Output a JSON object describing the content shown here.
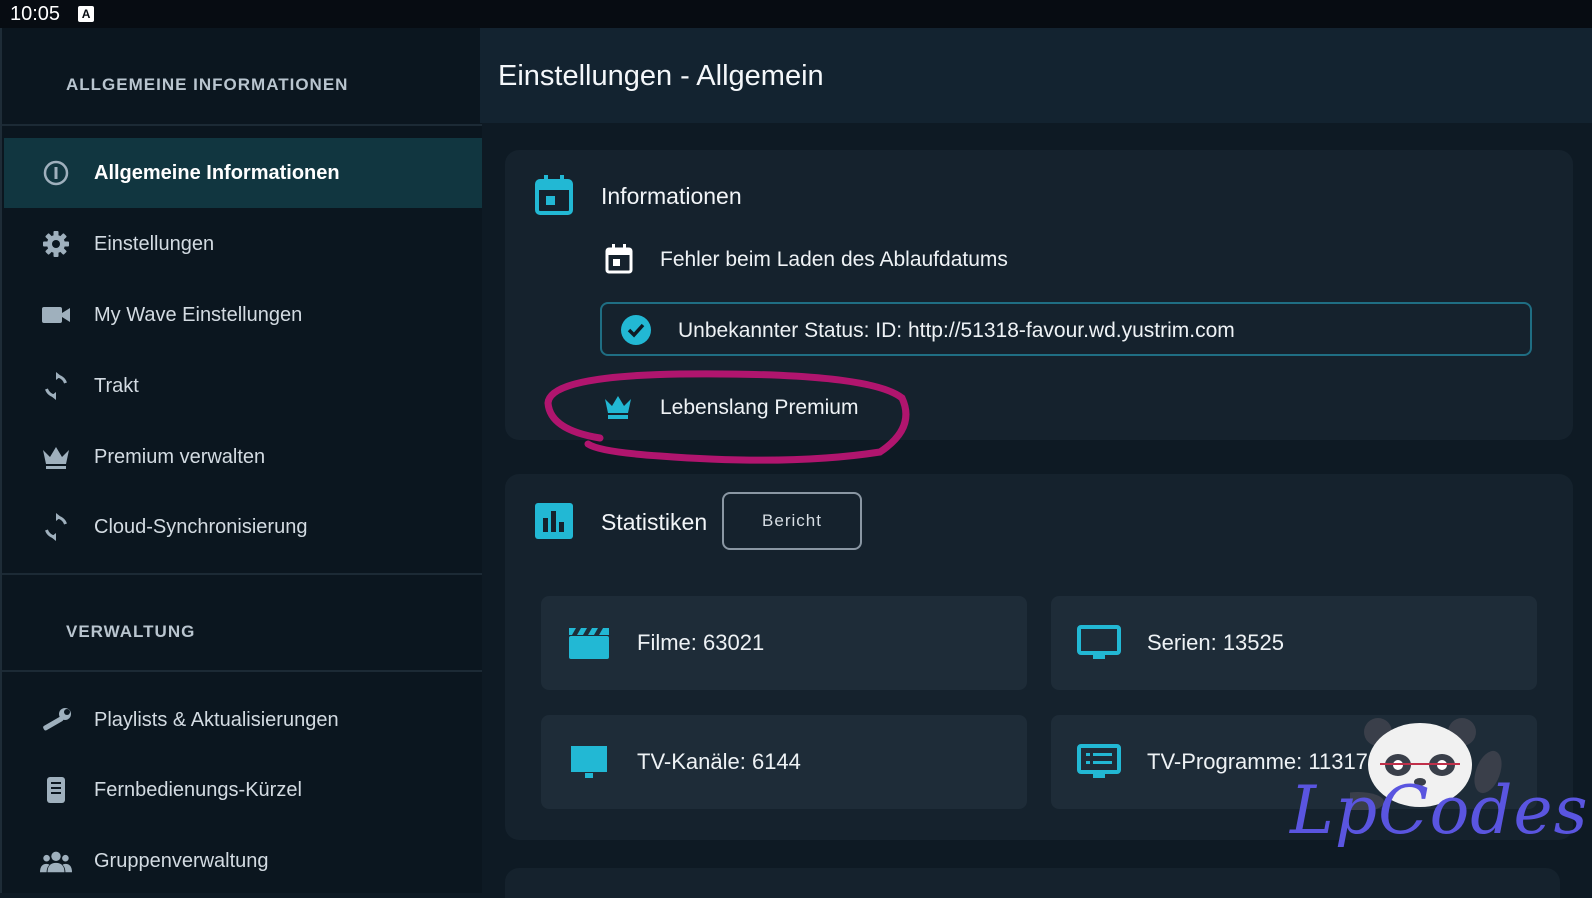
{
  "status_bar": {
    "time": "10:05",
    "notification_icon": "a-icon"
  },
  "sidebar": {
    "section1_title": "ALLGEMEINE INFORMATIONEN",
    "section2_title": "VERWALTUNG",
    "items": [
      {
        "label": "Allgemeine Informationen",
        "icon": "info-icon",
        "active": true
      },
      {
        "label": "Einstellungen",
        "icon": "gear-icon"
      },
      {
        "label": "My Wave Einstellungen",
        "icon": "video-camera-icon"
      },
      {
        "label": "Trakt",
        "icon": "sync-icon"
      },
      {
        "label": "Premium verwalten",
        "icon": "crown-icon"
      },
      {
        "label": "Cloud-Synchronisierung",
        "icon": "sync-icon"
      },
      {
        "label": "Playlists & Aktualisierungen",
        "icon": "wrench-icon"
      },
      {
        "label": "Fernbedienungs-Kürzel",
        "icon": "remote-icon"
      },
      {
        "label": "Gruppenverwaltung",
        "icon": "group-icon"
      }
    ]
  },
  "header": {
    "title": "Einstellungen - Allgemein"
  },
  "info_card": {
    "title": "Informationen",
    "expiry_text": "Fehler beim Laden des Ablaufdatums",
    "status_text": "Unbekannter Status: ID: http://51318-favour.wd.yustrim.com",
    "premium_text": "Lebenslang Premium"
  },
  "stats_card": {
    "title": "Statistiken",
    "report_button": "Bericht",
    "tiles": [
      {
        "label": "Filme: 63021",
        "icon": "clapperboard-icon"
      },
      {
        "label": "Serien: 13525",
        "icon": "monitor-icon"
      },
      {
        "label": "TV-Kanäle: 6144",
        "icon": "tv-icon"
      },
      {
        "label": "TV-Programme: 11317",
        "icon": "program-list-icon"
      }
    ]
  },
  "watermark": {
    "text": "LpCodes"
  },
  "colors": {
    "accent": "#22b8d4",
    "highlight": "#b0156e",
    "active_bg": "#113640"
  }
}
